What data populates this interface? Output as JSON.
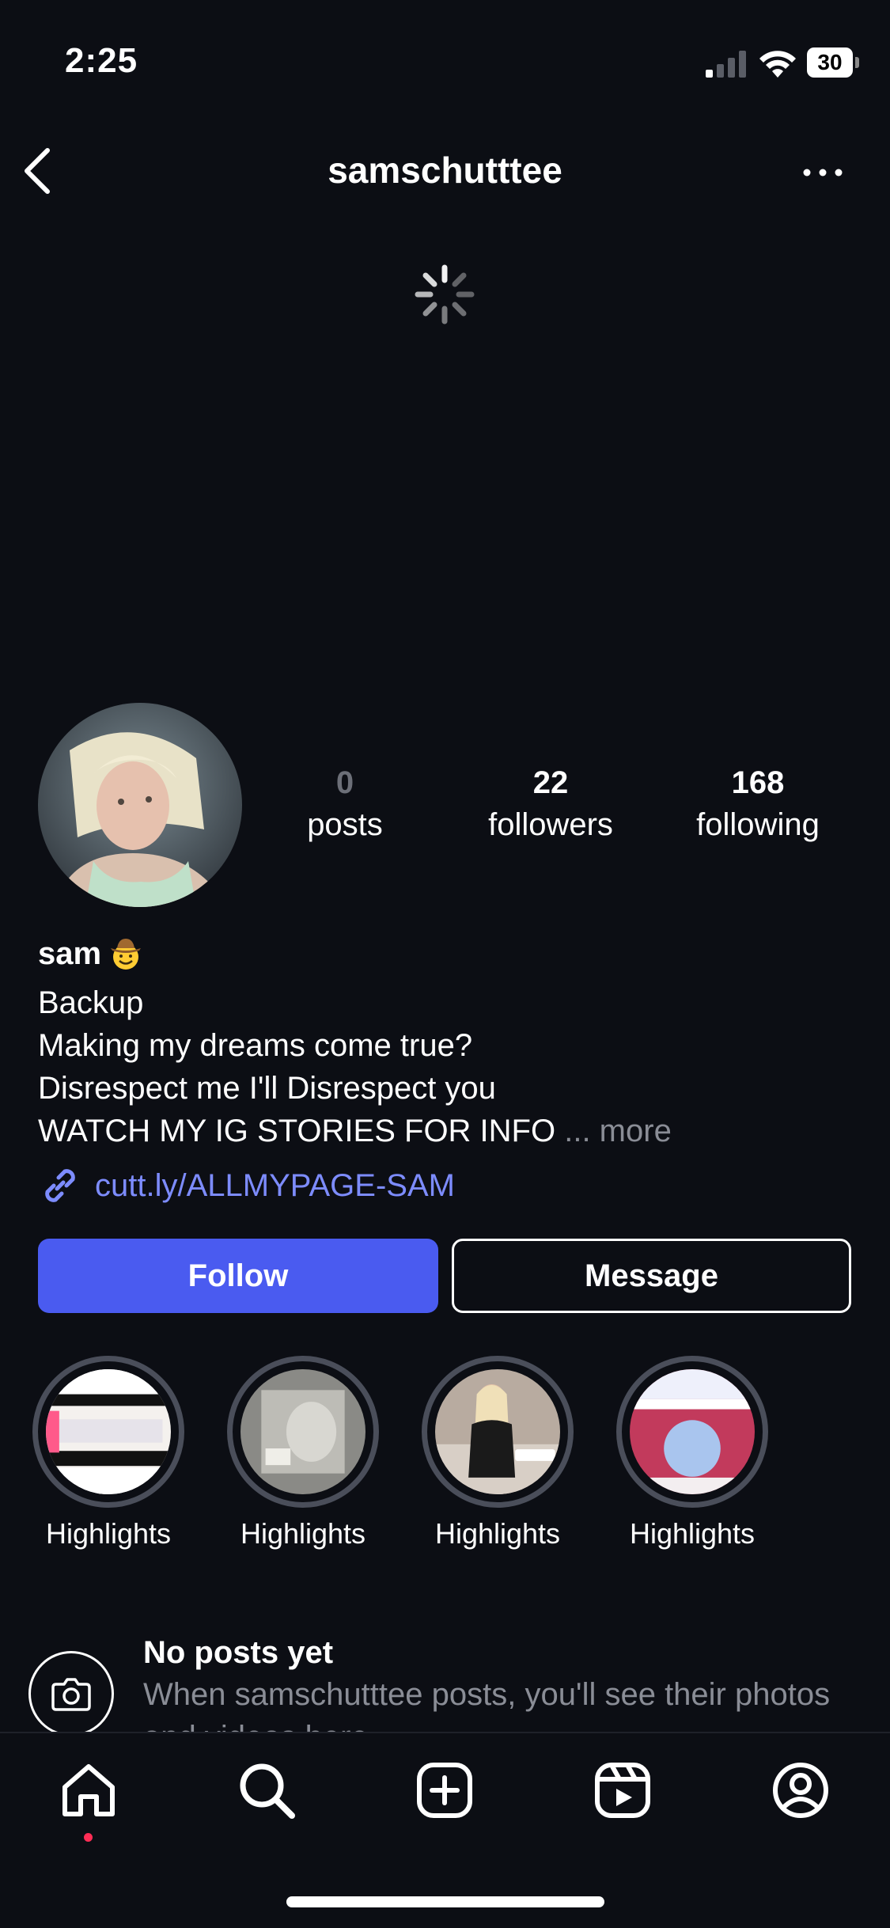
{
  "status_bar": {
    "time": "2:25",
    "battery": "30"
  },
  "header": {
    "username": "samschutttee"
  },
  "profile": {
    "stats": [
      {
        "value": "0",
        "label": "posts"
      },
      {
        "value": "22",
        "label": "followers"
      },
      {
        "value": "168",
        "label": "following"
      }
    ],
    "name": "sam",
    "name_emoji": "cowboy-face",
    "bio": {
      "line1": "Backup",
      "line2": "Making my dreams come true?",
      "line3": "Disrespect me I'll Disrespect you",
      "line4": "WATCH MY IG STORIES FOR INFO",
      "more": " ... more"
    },
    "link": "cutt.ly/ALLMYPAGE-SAM"
  },
  "actions": {
    "follow": "Follow",
    "message": "Message"
  },
  "highlights": [
    {
      "label": "Highlights"
    },
    {
      "label": "Highlights"
    },
    {
      "label": "Highlights"
    },
    {
      "label": "Highlights"
    }
  ],
  "empty_state": {
    "title": "No posts yet",
    "subtitle": "When samschutttee posts, you'll see their photos and videos here."
  },
  "tabbar": {
    "icons": [
      "home-icon",
      "search-icon",
      "create-icon",
      "reels-icon",
      "profile-icon"
    ]
  },
  "colors": {
    "background": "#0c0e14",
    "follow_button": "#4a5bf0",
    "link": "#7d8cff",
    "notification_dot": "#ff2d55"
  }
}
